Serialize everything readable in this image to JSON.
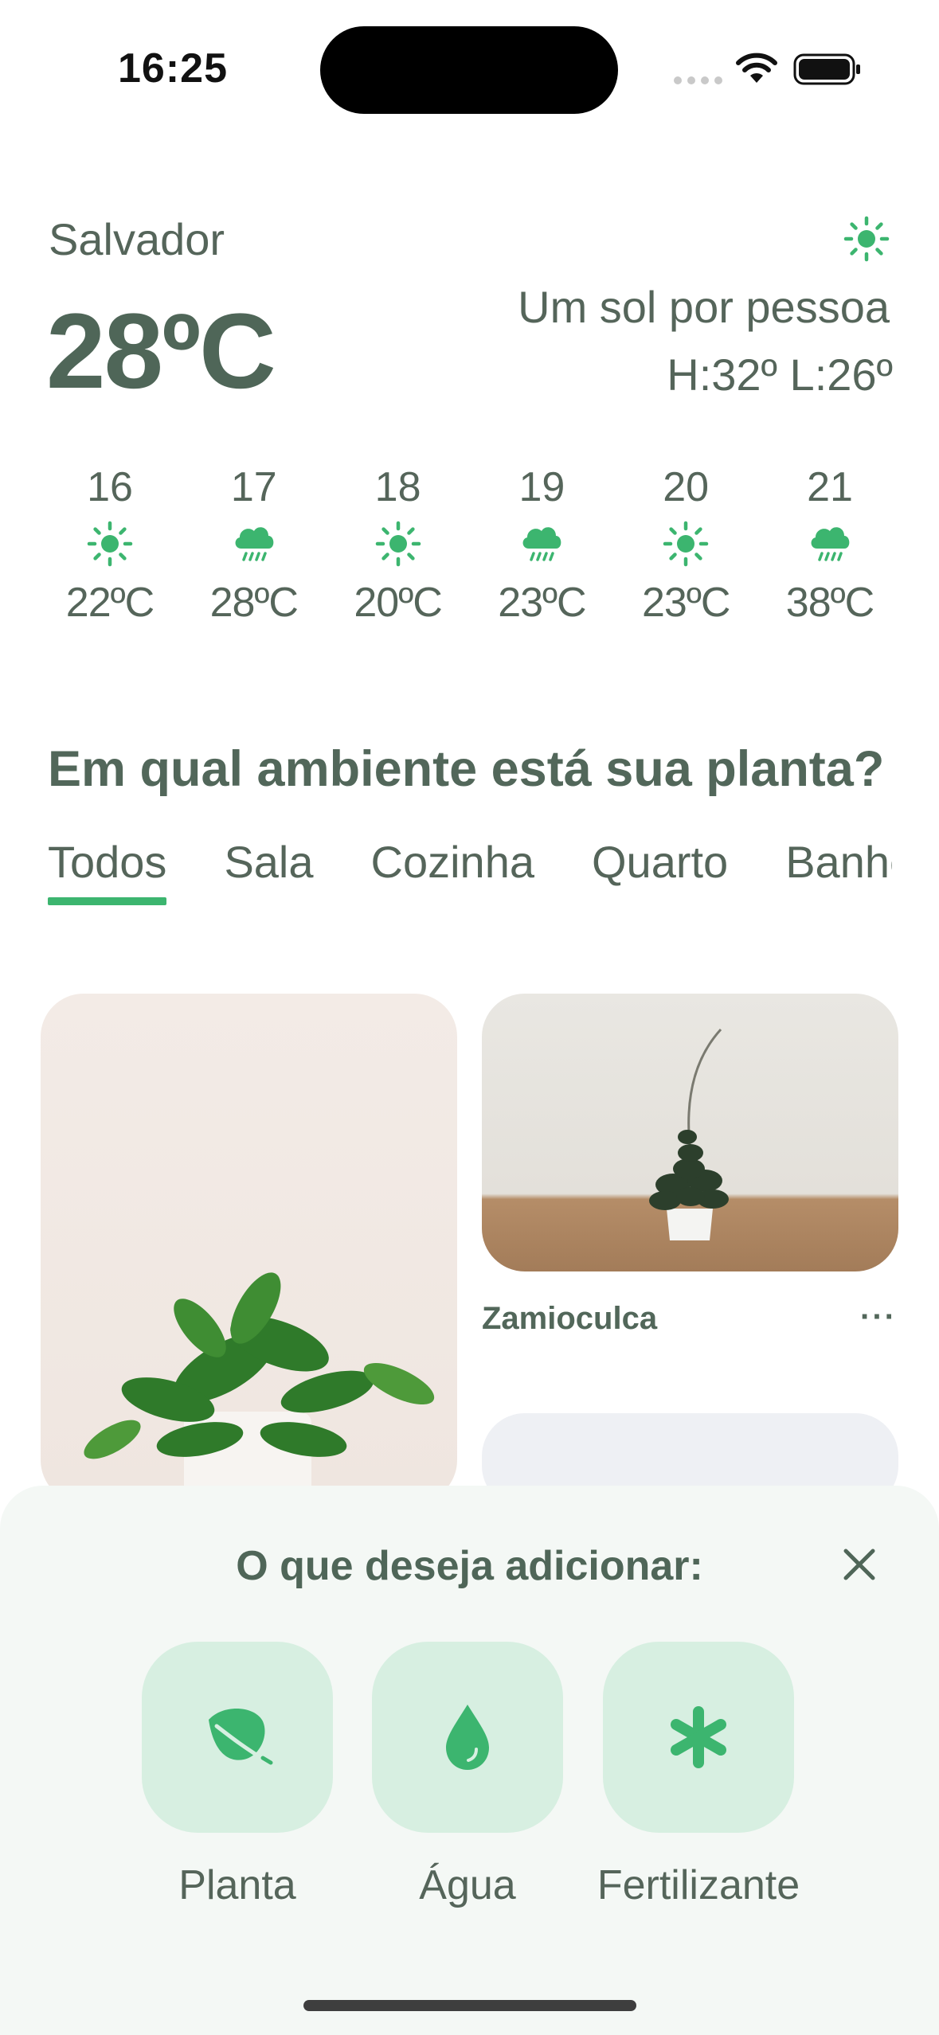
{
  "status_bar": {
    "time": "16:25"
  },
  "weather": {
    "city": "Salvador",
    "temperature": "28ºC",
    "summary": "Um sol por pessoa",
    "high_low": "H:32º L:26º",
    "current_icon": "sun-icon",
    "forecast": [
      {
        "day": "16",
        "icon": "sun-icon",
        "temp": "22ºC"
      },
      {
        "day": "17",
        "icon": "rain-cloud-icon",
        "temp": "28ºC"
      },
      {
        "day": "18",
        "icon": "sun-icon",
        "temp": "20ºC"
      },
      {
        "day": "19",
        "icon": "rain-cloud-icon",
        "temp": "23ºC"
      },
      {
        "day": "20",
        "icon": "sun-icon",
        "temp": "23ºC"
      },
      {
        "day": "21",
        "icon": "rain-cloud-icon",
        "temp": "38ºC"
      }
    ]
  },
  "rooms": {
    "title": "Em qual ambiente está sua planta?",
    "tabs": [
      "Todos",
      "Sala",
      "Cozinha",
      "Quarto",
      "Banhe"
    ],
    "active_tab": "Todos"
  },
  "plants": [
    {
      "name": "Zamioculca",
      "more": "···"
    }
  ],
  "add_sheet": {
    "title": "O que deseja adicionar:",
    "options": [
      {
        "label": "Planta",
        "icon": "leaf-icon"
      },
      {
        "label": "Água",
        "icon": "water-drop-icon"
      },
      {
        "label": "Fertilizante",
        "icon": "asterisk-icon"
      }
    ]
  },
  "colors": {
    "accent": "#3cb56f",
    "text": "#55655a",
    "heading": "#4f6658",
    "option_bg": "#d7efe1",
    "sheet_bg": "#f4f8f5"
  }
}
